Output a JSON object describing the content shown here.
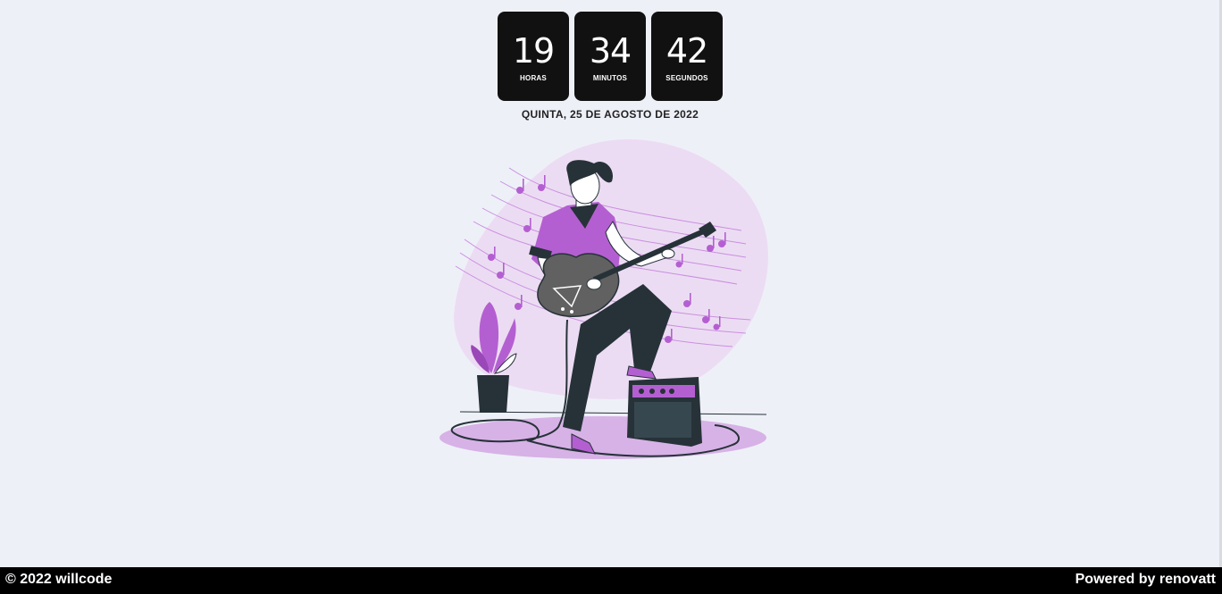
{
  "clock": {
    "hours": "19",
    "hours_label": "HORAS",
    "minutes": "34",
    "minutes_label": "MINUTOS",
    "seconds": "42",
    "seconds_label": "SEGUNDOS"
  },
  "date": "QUINTA, 25 DE AGOSTO DE 2022",
  "illustration": {
    "subject": "guitarist-illustration",
    "accent_color": "#b45fd1",
    "blob_color": "#ecdcf3",
    "dark_color": "#263238"
  },
  "footer": {
    "left_text": "© 2022 willcode",
    "right_text": "Powered by renovatt"
  },
  "colors": {
    "background": "#eef0f8",
    "clock_box": "#111111",
    "footer": "#000000"
  }
}
